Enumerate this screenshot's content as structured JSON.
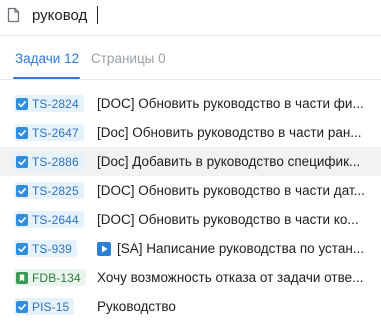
{
  "search": {
    "value": "руковод"
  },
  "tabs": [
    {
      "label": "Задачи 12",
      "active": true
    },
    {
      "label": "Страницы 0",
      "active": false
    }
  ],
  "colors": {
    "accent": "#2c79d6",
    "task_chip_bg": "#e5f1fb",
    "story_chip_bg": "#e9f5ec",
    "highlight_row": "#f1f2f4"
  },
  "results": [
    {
      "key": "TS-2824",
      "type_icon": "task-checkbox-icon",
      "title": "[DOC] Обновить руководство в части фи..."
    },
    {
      "key": "TS-2647",
      "type_icon": "task-checkbox-icon",
      "title": "[Doc] Обновить руководство в части ран..."
    },
    {
      "key": "TS-2886",
      "type_icon": "task-checkbox-icon",
      "title": "[Doc] Добавить в руководство специфик..."
    },
    {
      "key": "TS-2825",
      "type_icon": "task-checkbox-icon",
      "title": "[DOC] Обновить руководство в части дат..."
    },
    {
      "key": "TS-2644",
      "type_icon": "task-checkbox-icon",
      "title": "[DOC] Обновить руководство в части ко..."
    },
    {
      "key": "TS-939",
      "type_icon": "task-checkbox-icon",
      "title_icon": "play-icon",
      "title": "[SA] Написание руководства по устан..."
    },
    {
      "key": "FDB-134",
      "type_icon": "story-bookmark-icon",
      "title": "Хочу возможность отказа от задачи отве..."
    },
    {
      "key": "PIS-15",
      "type_icon": "task-checkbox-icon",
      "title": "Руководство"
    }
  ]
}
